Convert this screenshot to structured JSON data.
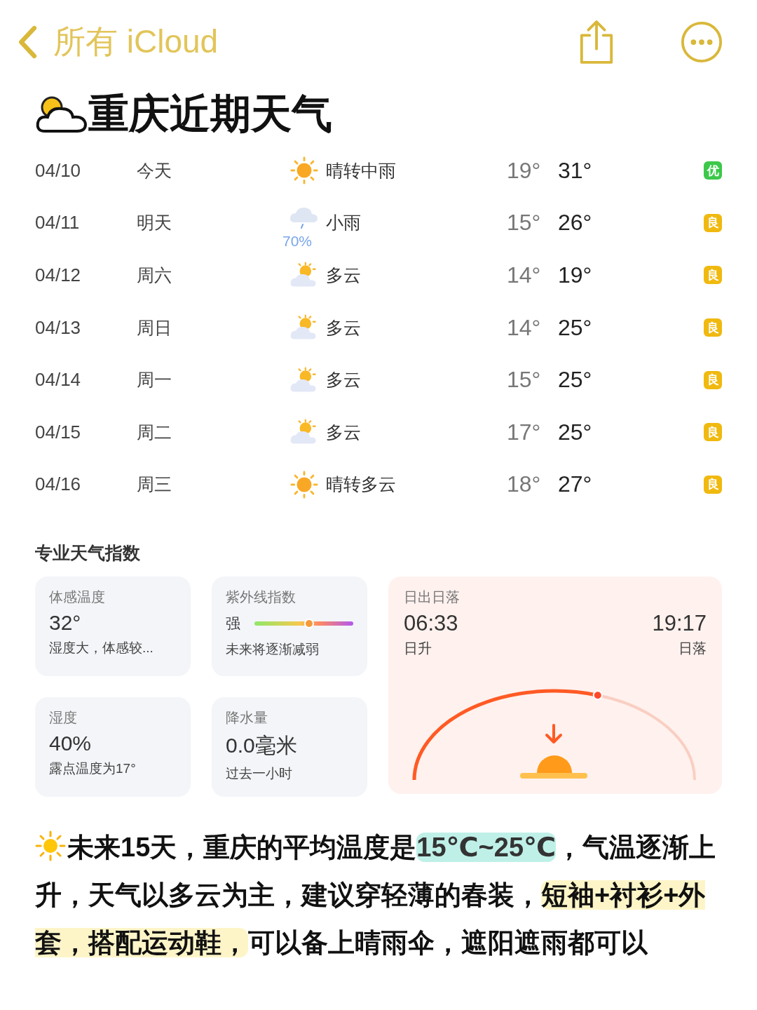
{
  "nav": {
    "back_label": "所有 iCloud"
  },
  "title": "重庆近期天气",
  "forecast": [
    {
      "date": "04/10",
      "day": "今天",
      "kind": "sun",
      "condition": "晴转中雨",
      "low": "19°",
      "high": "31°",
      "aqi": "优",
      "color": "#3cc84a"
    },
    {
      "date": "04/11",
      "day": "明天",
      "kind": "rain",
      "precip": "70%",
      "condition": "小雨",
      "low": "15°",
      "high": "26°",
      "aqi": "良",
      "color": "#f0b90f"
    },
    {
      "date": "04/12",
      "day": "周六",
      "kind": "partly",
      "condition": "多云",
      "low": "14°",
      "high": "19°",
      "aqi": "良",
      "color": "#f0b90f"
    },
    {
      "date": "04/13",
      "day": "周日",
      "kind": "partly",
      "condition": "多云",
      "low": "14°",
      "high": "25°",
      "aqi": "良",
      "color": "#f0b90f"
    },
    {
      "date": "04/14",
      "day": "周一",
      "kind": "partly",
      "condition": "多云",
      "low": "15°",
      "high": "25°",
      "aqi": "良",
      "color": "#f0b90f"
    },
    {
      "date": "04/15",
      "day": "周二",
      "kind": "partly",
      "condition": "多云",
      "low": "17°",
      "high": "25°",
      "aqi": "良",
      "color": "#f0b90f"
    },
    {
      "date": "04/16",
      "day": "周三",
      "kind": "sun",
      "condition": "晴转多云",
      "low": "18°",
      "high": "27°",
      "aqi": "良",
      "color": "#f0b90f"
    }
  ],
  "indices": {
    "title": "专业天气指数",
    "cards": [
      {
        "kind": "plain",
        "label": "体感温度",
        "value": "32°",
        "note": "湿度大，体感较..."
      },
      {
        "kind": "uv",
        "label": "紫外线指数",
        "value": "强",
        "level": 0.55,
        "note": "未来将逐渐减弱"
      },
      {
        "kind": "plain",
        "label": "湿度",
        "value": "40%",
        "note": "露点温度为17°"
      },
      {
        "kind": "plain",
        "label": "降水量",
        "value": "0.0毫米",
        "note": "过去一小时"
      }
    ],
    "sun": {
      "label": "日出日落",
      "sunrise": "06:33",
      "sunrise_label": "日升",
      "sunset": "19:17",
      "sunset_label": "日落"
    }
  },
  "note": [
    {
      "kind": "plain",
      "text": "未来15天，重庆的平均温度是"
    },
    {
      "kind": "teal",
      "text": "15℃~25℃"
    },
    {
      "kind": "plain",
      "text": "，气温逐渐上升，天气以多云为主，建议穿轻薄的春装，"
    },
    {
      "kind": "yellow",
      "text": "短袖+衬衫+外套，搭配运动鞋，"
    },
    {
      "kind": "plain",
      "text": "可以备上晴雨伞，遮阳遮雨都可以"
    }
  ]
}
